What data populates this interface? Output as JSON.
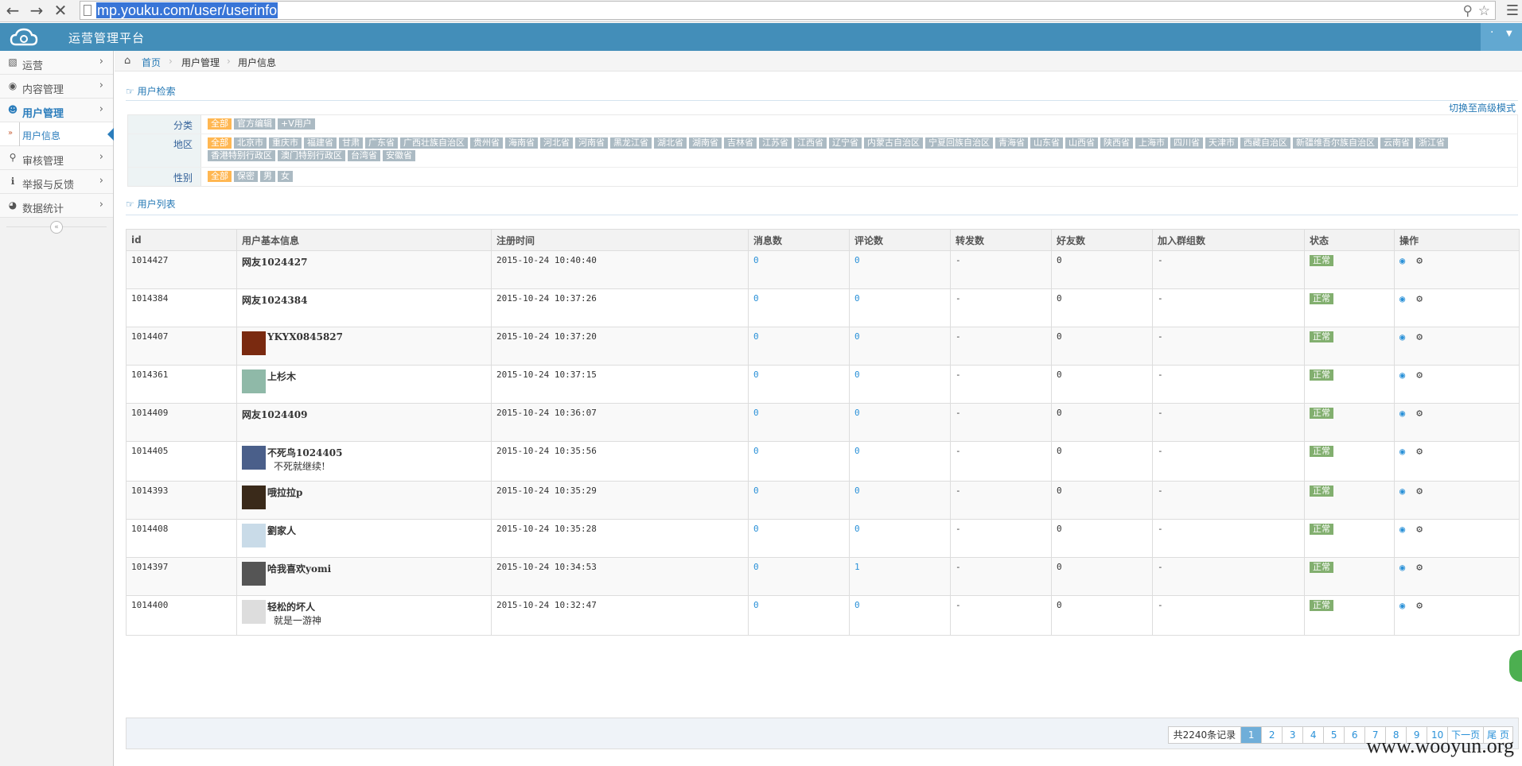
{
  "browser": {
    "url": "mp.youku.com/user/userinfo"
  },
  "header": {
    "title": "运营管理平台",
    "user_label": "·"
  },
  "sidebar": {
    "items": [
      {
        "label": "运营",
        "icon": "book-icon"
      },
      {
        "label": "内容管理",
        "icon": "comments-icon"
      },
      {
        "label": "用户管理",
        "icon": "user-icon",
        "active": true
      },
      {
        "label": "审核管理",
        "icon": "key-icon"
      },
      {
        "label": "举报与反馈",
        "icon": "info-icon"
      },
      {
        "label": "数据统计",
        "icon": "dashboard-icon"
      }
    ],
    "sub_item": "用户信息"
  },
  "breadcrumb": {
    "home": "首页",
    "level1": "用户管理",
    "level2": "用户信息"
  },
  "search": {
    "title": "用户检索",
    "advanced_link": "切换至高级模式"
  },
  "filters": {
    "category": {
      "label": "分类",
      "tags": [
        "全部",
        "官方编辑",
        "+V用户"
      ]
    },
    "region": {
      "label": "地区",
      "tags": [
        "全部",
        "北京市",
        "重庆市",
        "福建省",
        "甘肃",
        "广东省",
        "广西壮族自治区",
        "贵州省",
        "海南省",
        "河北省",
        "河南省",
        "黑龙江省",
        "湖北省",
        "湖南省",
        "吉林省",
        "江苏省",
        "江西省",
        "辽宁省",
        "内蒙古自治区",
        "宁夏回族自治区",
        "青海省",
        "山东省",
        "山西省",
        "陕西省",
        "上海市",
        "四川省",
        "天津市",
        "西藏自治区",
        "新疆维吾尔族自治区",
        "云南省",
        "浙江省",
        "香港特别行政区",
        "澳门特别行政区",
        "台湾省",
        "安徽省"
      ]
    },
    "gender": {
      "label": "性别",
      "tags": [
        "全部",
        "保密",
        "男",
        "女"
      ]
    }
  },
  "list": {
    "title": "用户列表",
    "columns": [
      "id",
      "用户基本信息",
      "注册时间",
      "消息数",
      "评论数",
      "转发数",
      "好友数",
      "加入群组数",
      "状态",
      "操作"
    ],
    "rows": [
      {
        "id": "1014427",
        "name": "网友1024427",
        "sig": "",
        "avatar": false,
        "time": "2015-10-24 10:40:40",
        "msg": "0",
        "cmt": "0",
        "fwd": "-",
        "friends": "0",
        "groups": "-",
        "status": "正常"
      },
      {
        "id": "1014384",
        "name": "网友1024384",
        "sig": "",
        "avatar": false,
        "time": "2015-10-24 10:37:26",
        "msg": "0",
        "cmt": "0",
        "fwd": "-",
        "friends": "0",
        "groups": "-",
        "status": "正常"
      },
      {
        "id": "1014407",
        "name": "YKYX0845827",
        "sig": "",
        "avatar": true,
        "avatar_color": "#7a2a10",
        "time": "2015-10-24 10:37:20",
        "msg": "0",
        "cmt": "0",
        "fwd": "-",
        "friends": "0",
        "groups": "-",
        "status": "正常"
      },
      {
        "id": "1014361",
        "name": "上杉木",
        "sig": "",
        "avatar": true,
        "avatar_color": "#8fb9a8",
        "time": "2015-10-24 10:37:15",
        "msg": "0",
        "cmt": "0",
        "fwd": "-",
        "friends": "0",
        "groups": "-",
        "status": "正常"
      },
      {
        "id": "1014409",
        "name": "网友1024409",
        "sig": "",
        "avatar": false,
        "time": "2015-10-24 10:36:07",
        "msg": "0",
        "cmt": "0",
        "fwd": "-",
        "friends": "0",
        "groups": "-",
        "status": "正常"
      },
      {
        "id": "1014405",
        "name": "不死鸟1024405",
        "sig": "不死就继续!",
        "avatar": true,
        "avatar_color": "#4a5f8a",
        "time": "2015-10-24 10:35:56",
        "msg": "0",
        "cmt": "0",
        "fwd": "-",
        "friends": "0",
        "groups": "-",
        "status": "正常"
      },
      {
        "id": "1014393",
        "name": "哦拉拉p",
        "sig": "",
        "avatar": true,
        "avatar_color": "#3a2a1a",
        "time": "2015-10-24 10:35:29",
        "msg": "0",
        "cmt": "0",
        "fwd": "-",
        "friends": "0",
        "groups": "-",
        "status": "正常"
      },
      {
        "id": "1014408",
        "name": "劉家人",
        "sig": "",
        "avatar": true,
        "avatar_color": "#c9dbe8",
        "time": "2015-10-24 10:35:28",
        "msg": "0",
        "cmt": "0",
        "fwd": "-",
        "friends": "0",
        "groups": "-",
        "status": "正常"
      },
      {
        "id": "1014397",
        "name": "哈我喜欢yomi",
        "sig": "",
        "avatar": true,
        "avatar_color": "#555555",
        "time": "2015-10-24 10:34:53",
        "msg": "0",
        "cmt": "1",
        "fwd": "-",
        "friends": "0",
        "groups": "-",
        "status": "正常"
      },
      {
        "id": "1014400",
        "name": "轻松的坏人",
        "sig": "就是一游神",
        "avatar": true,
        "avatar_color": "#dddddd",
        "time": "2015-10-24 10:32:47",
        "msg": "0",
        "cmt": "0",
        "fwd": "-",
        "friends": "0",
        "groups": "-",
        "status": "正常"
      }
    ]
  },
  "pagination": {
    "total": "共2240条记录",
    "pages": [
      "1",
      "2",
      "3",
      "4",
      "5",
      "6",
      "7",
      "8",
      "9",
      "10"
    ],
    "current": "1",
    "next": "下一页",
    "last": "尾 页"
  },
  "watermark": "www.wooyun.org",
  "colors": {
    "header": "#438eb9",
    "accent": "#2679b5",
    "tag": "#abbac3",
    "tag_selected": "#ffb752",
    "status": "#82af6f"
  }
}
